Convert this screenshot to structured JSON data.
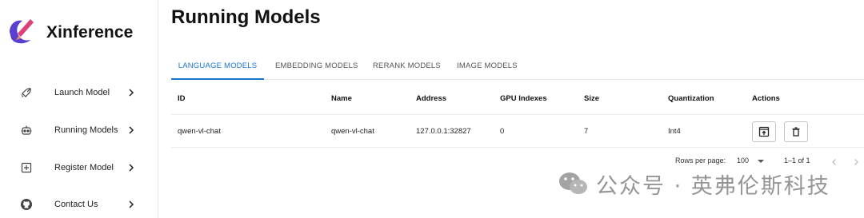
{
  "brand": {
    "name": "Xinference"
  },
  "sidebar": {
    "items": [
      {
        "label": "Launch Model",
        "icon": "rocket-icon"
      },
      {
        "label": "Running Models",
        "icon": "robot-icon"
      },
      {
        "label": "Register Model",
        "icon": "plus-box-icon"
      },
      {
        "label": "Contact Us",
        "icon": "github-icon"
      }
    ]
  },
  "main": {
    "title": "Running Models",
    "tabs": [
      {
        "label": "LANGUAGE MODELS",
        "active": true
      },
      {
        "label": "EMBEDDING MODELS",
        "active": false
      },
      {
        "label": "RERANK MODELS",
        "active": false
      },
      {
        "label": "IMAGE MODELS",
        "active": false
      }
    ],
    "table": {
      "headers": [
        "ID",
        "Name",
        "Address",
        "GPU Indexes",
        "Size",
        "Quantization",
        "Actions"
      ],
      "rows": [
        {
          "id": "qwen-vl-chat",
          "name": "qwen-vl-chat",
          "address": "127.0.0.1:32827",
          "gpu_indexes": "0",
          "size": "7",
          "quantization": "Int4",
          "actions": [
            "open-in-new-icon",
            "delete-icon"
          ]
        }
      ]
    },
    "pagination": {
      "rows_per_page_label": "Rows per page:",
      "rows_per_page_value": "100",
      "range_label": "1–1 of 1"
    }
  },
  "watermark": {
    "text": "公众号 · 英弗伦斯科技"
  },
  "colors": {
    "accent": "#1976d2",
    "logo_primary": "#5b3fd1",
    "logo_secondary": "#e0407a"
  }
}
